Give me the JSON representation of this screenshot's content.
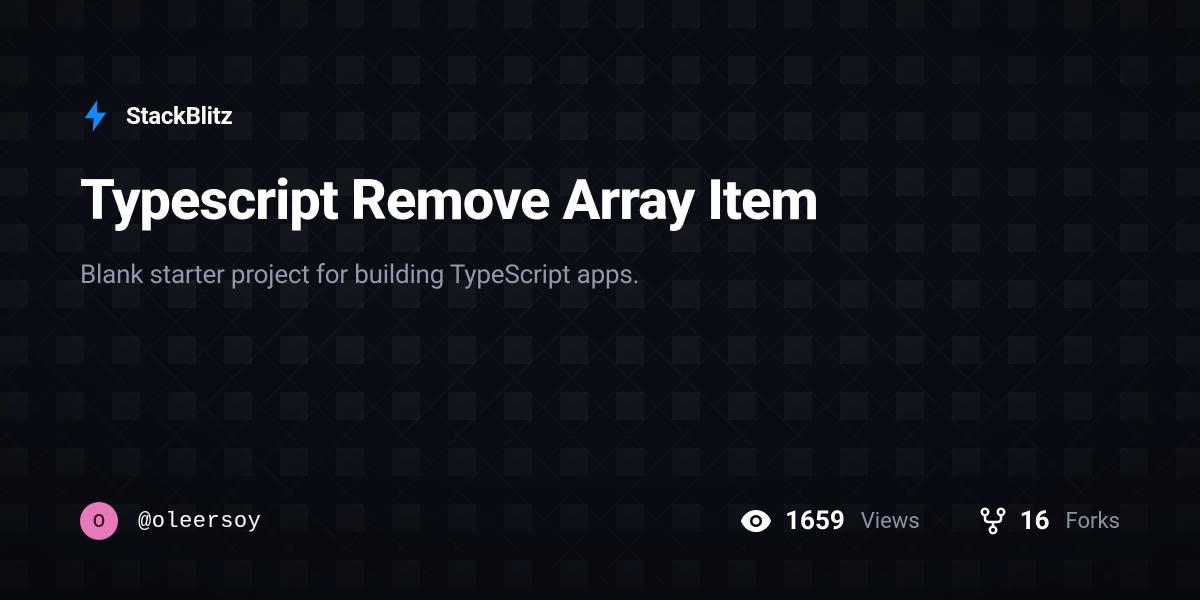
{
  "brand": {
    "name": "StackBlitz",
    "accent_color": "#1389fd"
  },
  "project": {
    "title": "Typescript Remove Array Item",
    "description": "Blank starter project for building TypeScript apps."
  },
  "author": {
    "avatar_initial": "O",
    "username": "@oleersoy",
    "avatar_color": "#e879b9"
  },
  "stats": {
    "views": {
      "value": "1659",
      "label": "Views"
    },
    "forks": {
      "value": "16",
      "label": "Forks"
    }
  }
}
